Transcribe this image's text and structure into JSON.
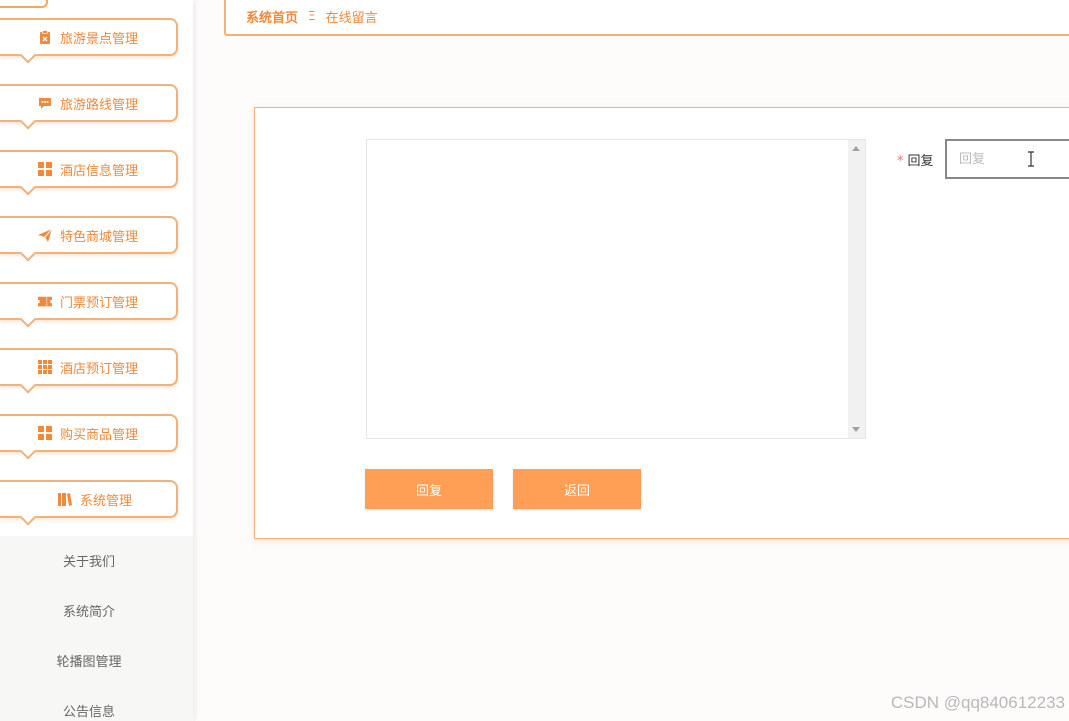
{
  "sidebar": {
    "items": [
      {
        "label": "旅游景点管理",
        "icon": "clipboard-icon"
      },
      {
        "label": "旅游路线管理",
        "icon": "chat-icon"
      },
      {
        "label": "酒店信息管理",
        "icon": "grid-icon"
      },
      {
        "label": "特色商城管理",
        "icon": "paper-plane-icon"
      },
      {
        "label": "门票预订管理",
        "icon": "ticket-icon"
      },
      {
        "label": "酒店预订管理",
        "icon": "grid-nine-icon"
      },
      {
        "label": "购买商品管理",
        "icon": "grid-icon"
      },
      {
        "label": "系统管理",
        "icon": "book-icon"
      }
    ],
    "subitems": [
      "关于我们",
      "系统简介",
      "轮播图管理",
      "公告信息"
    ]
  },
  "breadcrumb": {
    "home": "系统首页",
    "separator": "Ξ",
    "current": "在线留言"
  },
  "form": {
    "reply_label": "回复",
    "required_mark": "*",
    "reply_placeholder": "回复",
    "reply_value": "",
    "submit_label": "回复",
    "back_label": "返回"
  },
  "watermark": "CSDN @qq840612233",
  "colors": {
    "accent": "#ef8a3c",
    "border": "#f0b27a",
    "button": "#ff9f55"
  }
}
